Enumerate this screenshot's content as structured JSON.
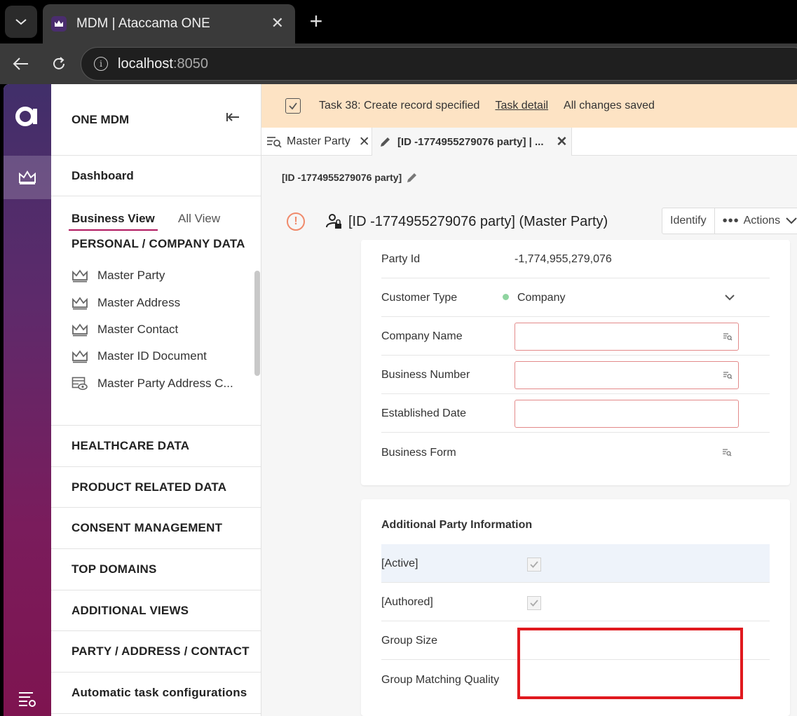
{
  "browser": {
    "tab_title": "MDM | Ataccama ONE",
    "url_host": "localhost",
    "url_port": ":8050"
  },
  "sidebar": {
    "title": "ONE MDM",
    "dashboard": "Dashboard",
    "views": [
      "Business View",
      "All View"
    ],
    "personal_section": "PERSONAL / COMPANY DATA",
    "personal_items": [
      "Master Party",
      "Master Address",
      "Master Contact",
      "Master ID Document",
      "Master Party Address C..."
    ],
    "sections": [
      "HEALTHCARE DATA",
      "PRODUCT RELATED DATA",
      "CONSENT MANAGEMENT",
      "TOP DOMAINS",
      "ADDITIONAL VIEWS",
      "PARTY / ADDRESS / CONTACT",
      "Automatic task configurations"
    ]
  },
  "task": {
    "text": "Task 38: Create record specified",
    "detail_link": "Task detail",
    "status": "All changes saved"
  },
  "tabs": {
    "tab1": "Master Party",
    "tab2": "[ID -1774955279076 party] | ..."
  },
  "record": {
    "breadcrumb": "[ID -1774955279076 party]",
    "title": "[ID -1774955279076 party]  (Master Party)",
    "identify": "Identify",
    "actions": "Actions"
  },
  "card1": {
    "party_id_label": "Party Id",
    "party_id_value": "-1,774,955,279,076",
    "customer_type_label": "Customer Type",
    "customer_type_value": "Company",
    "company_name_label": "Company Name",
    "business_number_label": "Business Number",
    "established_date_label": "Established Date",
    "business_form_label": "Business Form"
  },
  "card2": {
    "title": "Additional Party Information",
    "active_label": "[Active]",
    "authored_label": "[Authored]",
    "group_size_label": "Group Size",
    "group_matching_label": "Group Matching Quality"
  },
  "colors": {
    "accent": "#b0185f",
    "task_bar": "#fde3c4",
    "error_border": "#e38a8a",
    "highlight": "#e0191e"
  }
}
